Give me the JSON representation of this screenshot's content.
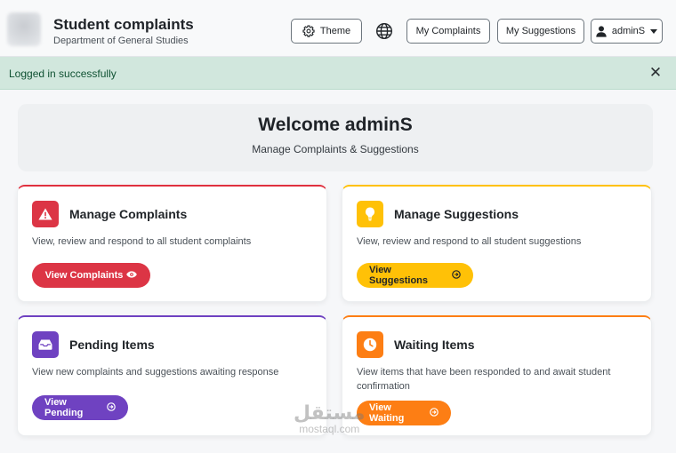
{
  "header": {
    "title": "Student complaints",
    "subtitle": "Department of General Studies",
    "theme_label": "Theme",
    "theme_icon": "gear-icon",
    "language_icon": "globe-icon",
    "my_complaints_label": "My Complaints",
    "my_suggestions_label": "My Suggestions",
    "user_label": "adminS",
    "user_icon": "user-icon"
  },
  "alert": {
    "message": "Logged in successfully",
    "close_glyph": "✕",
    "color": "#d1e7dd"
  },
  "welcome": {
    "title": "Welcome adminS",
    "subtitle": "Manage Complaints & Suggestions"
  },
  "cards": [
    {
      "title": "Manage Complaints",
      "description": "View, review and respond to all student complaints",
      "button_label": "View Complaints",
      "icon": "warning-icon",
      "button_icon": "eye-icon",
      "accent": "#dc3545"
    },
    {
      "title": "Manage Suggestions",
      "description": "View, review and respond to all student suggestions",
      "button_label": "View Suggestions",
      "icon": "lightbulb-icon",
      "button_icon": "arrow-circle-icon",
      "accent": "#ffc107"
    },
    {
      "title": "Pending Items",
      "description": "View new complaints and suggestions awaiting response",
      "button_label": "View Pending",
      "icon": "inbox-icon",
      "button_icon": "arrow-circle-icon",
      "accent": "#6f42c1"
    },
    {
      "title": "Waiting Items",
      "description": "View items that have been responded to and await student confirmation",
      "button_label": "View Waiting",
      "icon": "clock-icon",
      "button_icon": "arrow-circle-icon",
      "accent": "#fd7e14"
    }
  ],
  "watermark": {
    "arabic": "مستقل",
    "latin": "mostaql.com"
  }
}
